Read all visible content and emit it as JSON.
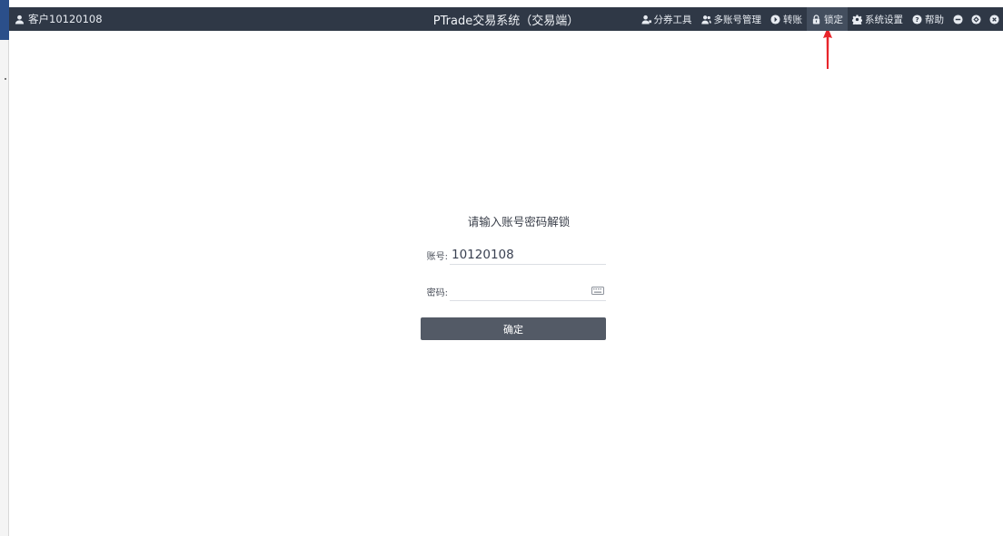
{
  "titlebar": {
    "customer_label": "客户10120108",
    "title": "PTrade交易系统（交易端）",
    "menu": [
      {
        "label": "分券工具",
        "icon": "user-icon"
      },
      {
        "label": "多账号管理",
        "icon": "users-icon"
      },
      {
        "label": "转账",
        "icon": "circle-arrow-icon"
      },
      {
        "label": "锁定",
        "icon": "lock-icon"
      },
      {
        "label": "系统设置",
        "icon": "gear-icon"
      },
      {
        "label": "帮助",
        "icon": "help-icon"
      }
    ],
    "window_controls": [
      "minimize-icon",
      "restore-icon",
      "close-icon"
    ]
  },
  "unlock_form": {
    "title": "请输入账号密码解锁",
    "account_label": "账号:",
    "account_value": "10120108",
    "password_label": "密码:",
    "password_value": "",
    "confirm_label": "确定"
  },
  "colors": {
    "titlebar_bg": "#2f3846",
    "button_bg": "#535a66",
    "arrow": "#e8252b"
  }
}
